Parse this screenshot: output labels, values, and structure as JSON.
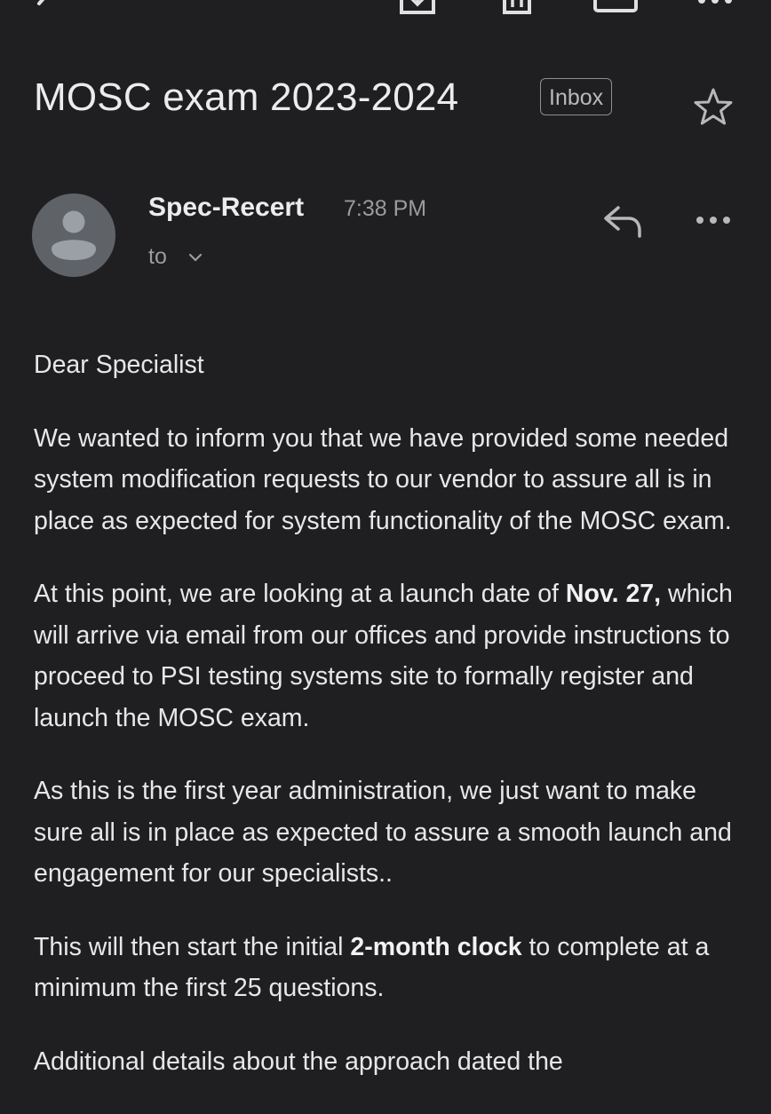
{
  "toolbar": {
    "icons": [
      "back-arrow-icon",
      "archive-icon",
      "delete-icon",
      "mail-icon",
      "more-icon"
    ]
  },
  "subject": {
    "title": "MOSC exam 2023-2024",
    "label": "Inbox"
  },
  "sender": {
    "name": "Spec-Recert",
    "time": "7:38 PM",
    "to_label": "to"
  },
  "body": {
    "greeting": "Dear Specialist",
    "p1": "We wanted to inform you that we have provided some needed system modification requests to our vendor to assure all is in place as expected for system functionality of the MOSC exam.",
    "p2_before": "At this point, we are looking at a launch date of ",
    "p2_bold": "Nov. 27,",
    "p2_after": " which will arrive via email from our offices and provide instructions to proceed to PSI testing systems site to formally register and launch the MOSC exam.",
    "p3": "As this is the first year administration, we just want to make sure all is in place as expected to assure a smooth launch and engagement for our specialists..",
    "p4_before": "This will then start the initial ",
    "p4_bold": "2-month clock",
    "p4_after": " to complete at a minimum the first 25 questions.",
    "p5_partial": "Additional details about the approach dated the"
  },
  "colors": {
    "background": "#1f1f21",
    "text": "#e7e7e9",
    "muted": "#9a9a9f",
    "avatar_bg": "#5f6368",
    "avatar_fg": "#9aa0a6"
  }
}
